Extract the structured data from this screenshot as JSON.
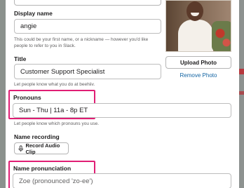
{
  "display_name": {
    "label": "Display name",
    "value": "angie",
    "hint": "This could be your first name, or a nickname — however you'd like people to refer to you in Slack."
  },
  "title": {
    "label": "Title",
    "value": "Customer Support Specialist",
    "hint": "Let people know what you do at beehiiv."
  },
  "pronouns": {
    "label": "Pronouns",
    "value": "Sun - Thu | 11a - 8p ET",
    "hint": "Let people know which pronouns you use."
  },
  "name_recording": {
    "label": "Name recording",
    "button_label": "Record Audio Clip"
  },
  "name_pronunciation": {
    "label": "Name pronunciation",
    "placeholder": "Zoe (pronounced 'zo-ee')"
  },
  "photo": {
    "upload_label": "Upload Photo",
    "remove_label": "Remove Photo"
  },
  "colors": {
    "highlight": "#e01e74",
    "link": "#1264a3"
  }
}
